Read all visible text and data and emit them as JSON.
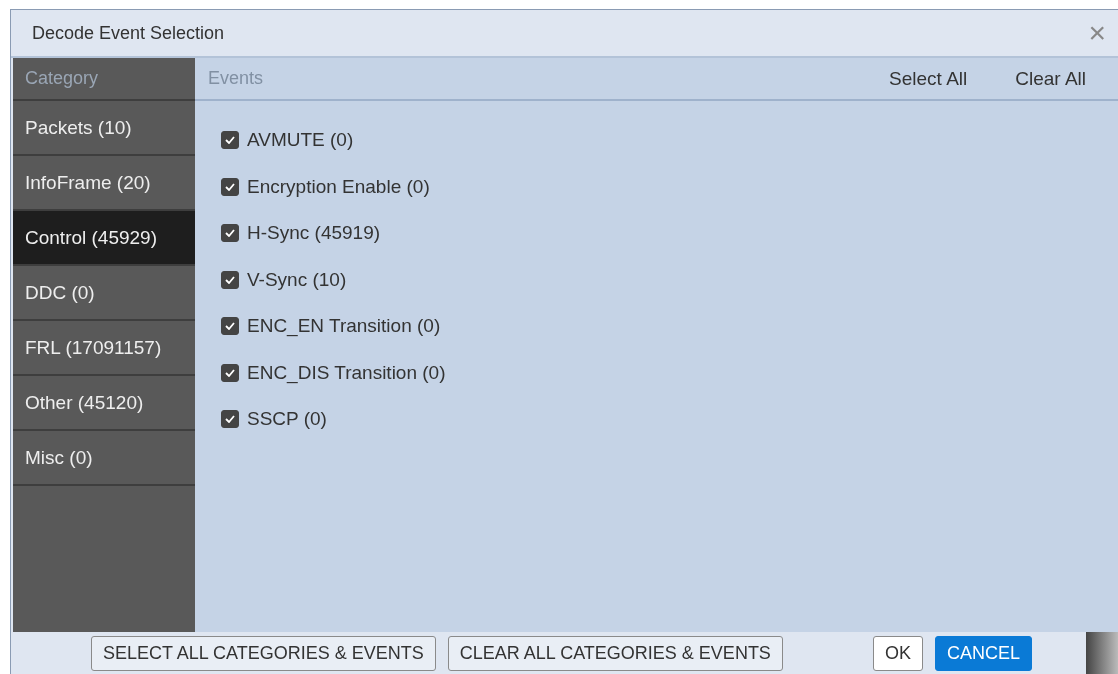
{
  "window": {
    "title": "Decode Event Selection",
    "close": "×"
  },
  "sidebar": {
    "header": "Category",
    "items": [
      {
        "label": "Packets (10)",
        "selected": false
      },
      {
        "label": "InfoFrame (20)",
        "selected": false
      },
      {
        "label": "Control (45929)",
        "selected": true
      },
      {
        "label": "DDC (0)",
        "selected": false
      },
      {
        "label": "FRL (17091157)",
        "selected": false
      },
      {
        "label": "Other (45120)",
        "selected": false
      },
      {
        "label": "Misc (0)",
        "selected": false
      }
    ]
  },
  "events": {
    "header": "Events",
    "select_all": "Select All",
    "clear_all": "Clear All",
    "items": [
      {
        "label": "AVMUTE (0)",
        "checked": true
      },
      {
        "label": "Encryption Enable (0)",
        "checked": true
      },
      {
        "label": "H-Sync (45919)",
        "checked": true
      },
      {
        "label": "V-Sync (10)",
        "checked": true
      },
      {
        "label": "ENC_EN Transition (0)",
        "checked": true
      },
      {
        "label": "ENC_DIS Transition (0)",
        "checked": true
      },
      {
        "label": "SSCP (0)",
        "checked": true
      }
    ]
  },
  "footer": {
    "select_all_categories": "SELECT ALL CATEGORIES & EVENTS",
    "clear_all_categories": "CLEAR ALL CATEGORIES & EVENTS",
    "ok": "OK",
    "cancel": "CANCEL"
  }
}
